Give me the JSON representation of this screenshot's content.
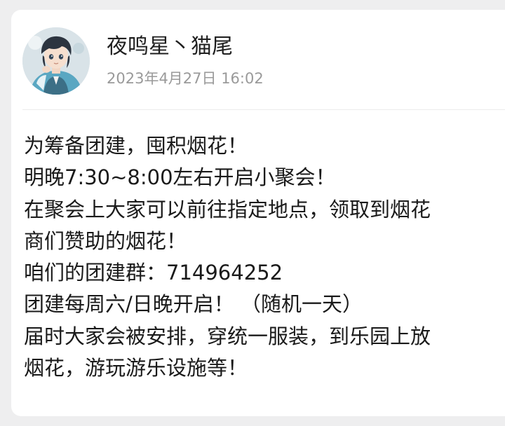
{
  "post": {
    "author": {
      "name": "夜鸣星丶猫尾",
      "avatar_icon": "anime-boy-avatar-icon"
    },
    "timestamp": "2023年4月27日 16:02",
    "lines": [
      "为筹备团建，囤积烟花！",
      "明晚7:30~8:00左右开启小聚会！",
      "在聚会上大家可以前往指定地点，领取到烟花",
      "商们赞助的烟花！",
      "咱们的团建群：714964252",
      "团建每周六/日晚开启！ （随机一天）",
      "届时大家会被安排，穿统一服装，到乐园上放",
      "烟花，游玩游乐设施等！"
    ]
  }
}
